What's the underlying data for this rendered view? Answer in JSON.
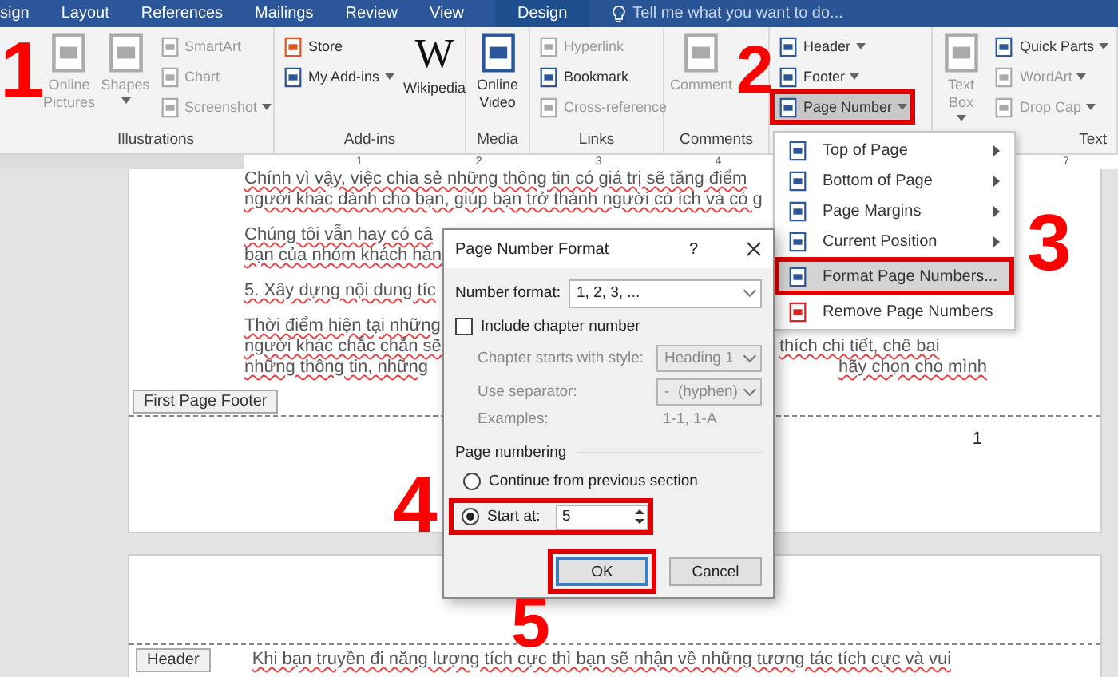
{
  "ribbon_tabs": [
    {
      "label": "sign",
      "kind": "normal"
    },
    {
      "label": "Layout",
      "kind": "normal"
    },
    {
      "label": "References",
      "kind": "normal"
    },
    {
      "label": "Mailings",
      "kind": "normal"
    },
    {
      "label": "Review",
      "kind": "normal"
    },
    {
      "label": "View",
      "kind": "normal"
    },
    {
      "label": "Design",
      "kind": "contextual"
    }
  ],
  "search": {
    "placeholder": "Tell me what you want to do..."
  },
  "ribbon_groups": [
    {
      "label": "Illustrations",
      "items": [
        {
          "kind": "large",
          "label": "Online Pictures",
          "disabled": true,
          "dropdown": false
        },
        {
          "kind": "large",
          "label": "Shapes",
          "disabled": true,
          "dropdown": true
        },
        {
          "kind": "stack",
          "buttons": [
            {
              "label": "SmartArt",
              "disabled": true,
              "dropdown": false
            },
            {
              "label": "Chart",
              "disabled": true,
              "dropdown": false
            },
            {
              "label": "Screenshot",
              "disabled": true,
              "dropdown": true
            }
          ]
        }
      ]
    },
    {
      "label": "Add-ins",
      "items": [
        {
          "kind": "stack",
          "buttons": [
            {
              "label": "Store",
              "disabled": false,
              "dropdown": false
            },
            {
              "label": "My Add-ins",
              "disabled": false,
              "dropdown": true
            }
          ]
        },
        {
          "kind": "large",
          "logo": "W",
          "label": "Wikipedia",
          "disabled": false,
          "dropdown": false
        }
      ]
    },
    {
      "label": "Media",
      "items": [
        {
          "kind": "large",
          "label": "Online Video",
          "disabled": false,
          "dropdown": false
        }
      ]
    },
    {
      "label": "Links",
      "items": [
        {
          "kind": "stack",
          "buttons": [
            {
              "label": "Hyperlink",
              "disabled": true,
              "dropdown": false
            },
            {
              "label": "Bookmark",
              "disabled": false,
              "dropdown": false
            },
            {
              "label": "Cross-reference",
              "disabled": true,
              "dropdown": false
            }
          ]
        }
      ]
    },
    {
      "label": "Comments",
      "items": [
        {
          "kind": "large",
          "label": "Comment",
          "disabled": true,
          "dropdown": false
        }
      ]
    },
    {
      "items": [
        {
          "kind": "stack",
          "buttons": [
            {
              "label": "Header",
              "disabled": false,
              "dropdown": true,
              "selected": false
            },
            {
              "label": "Footer",
              "disabled": false,
              "dropdown": true,
              "selected": false
            },
            {
              "label": "Page Number",
              "disabled": false,
              "dropdown": true,
              "selected": true
            }
          ]
        }
      ]
    },
    {
      "label": "Text",
      "items": [
        {
          "kind": "large",
          "label": "Text Box",
          "disabled": true,
          "dropdown": true
        },
        {
          "kind": "stack",
          "buttons": [
            {
              "label": "Quick Parts",
              "disabled": false,
              "dropdown": true
            },
            {
              "label": "WordArt",
              "disabled": true,
              "dropdown": true
            },
            {
              "label": "Drop Cap",
              "disabled": true,
              "dropdown": true
            }
          ]
        }
      ]
    }
  ],
  "page_number_menu": {
    "items": [
      {
        "label": "Top of Page",
        "submenu": true,
        "selected": false
      },
      {
        "label": "Bottom of Page",
        "submenu": true,
        "selected": false
      },
      {
        "label": "Page Margins",
        "submenu": true,
        "selected": false
      },
      {
        "label": "Current Position",
        "submenu": true,
        "selected": false
      },
      {
        "label": "Format Page Numbers...",
        "submenu": false,
        "selected": true
      },
      {
        "label": "Remove Page Numbers",
        "submenu": false,
        "selected": false
      }
    ]
  },
  "document": {
    "ruler": [
      "1",
      "2",
      "3",
      "4",
      "7"
    ],
    "paragraphs": [
      [
        "Chính vì vậy, việc chia sẻ những thông tin có giá trị sẽ tăng điểm",
        "người khác dành cho bạn, giúp bạn trở thành người có ích và có g"
      ],
      [
        "Chúng tôi vẫn hay có câ",
        "bạn của nhóm khách hàn"
      ],
      [
        "5. Xây dựng nội dung tíc"
      ],
      [
        "Thời điểm hiện tại những",
        "người khác chắc chắn sẽ",
        "những thông tin, những"
      ]
    ],
    "right_fragments": [
      "thích chi tiết, chê bai",
      "hãy chọn cho mình"
    ],
    "footer_tag": "First Page Footer",
    "page_number": "1",
    "header_tag": "Header",
    "next_page_text": "Khi bạn truyền đi năng lượng tích cực thì bạn sẽ nhận về những tương tác tích cực và vui"
  },
  "dialog": {
    "title": "Page Number Format",
    "help": "?",
    "number_format": {
      "label": "Number format:",
      "value": "1, 2, 3, ..."
    },
    "include_chapter": {
      "label": "Include chapter number",
      "checked": false
    },
    "chapter_style": {
      "label": "Chapter starts with style:",
      "value": "Heading 1",
      "disabled": true
    },
    "separator": {
      "label": "Use separator:",
      "value": "-  (hyphen)",
      "disabled": true
    },
    "examples": {
      "label": "Examples:",
      "value": "1-1, 1-A"
    },
    "page_numbering": {
      "title": "Page numbering",
      "options": [
        {
          "label": "Continue from previous section",
          "selected": false
        },
        {
          "label": "Start at:",
          "selected": true
        }
      ],
      "start_at": "5"
    },
    "buttons": [
      {
        "label": "OK",
        "default": true
      },
      {
        "label": "Cancel",
        "default": false
      }
    ]
  },
  "annotations": [
    "1",
    "2",
    "3",
    "4",
    "5"
  ]
}
